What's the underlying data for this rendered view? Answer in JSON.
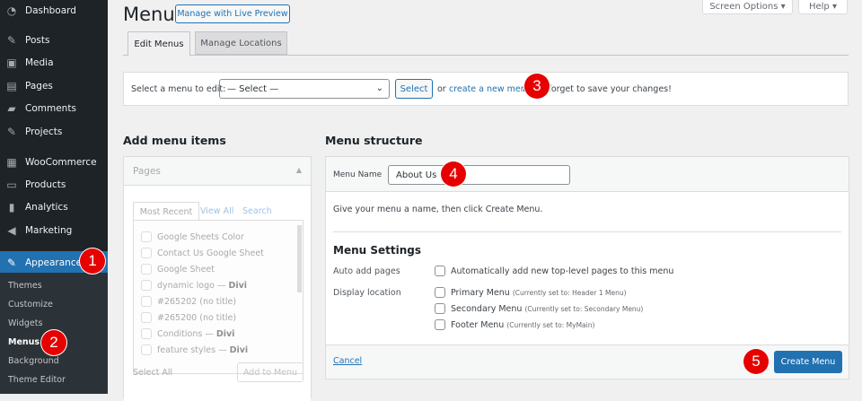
{
  "sidebar": {
    "items": [
      {
        "label": "Dashboard",
        "icon": "dashboard-icon"
      },
      {
        "label": "Posts",
        "icon": "pin-icon"
      },
      {
        "label": "Media",
        "icon": "media-icon"
      },
      {
        "label": "Pages",
        "icon": "pages-icon"
      },
      {
        "label": "Comments",
        "icon": "comment-icon"
      },
      {
        "label": "Projects",
        "icon": "pin-icon"
      },
      {
        "label": "WooCommerce",
        "icon": "woocommerce-icon"
      },
      {
        "label": "Products",
        "icon": "archive-icon"
      },
      {
        "label": "Analytics",
        "icon": "chart-icon"
      },
      {
        "label": "Marketing",
        "icon": "megaphone-icon"
      },
      {
        "label": "Appearance",
        "icon": "brush-icon"
      }
    ],
    "submenu": [
      "Themes",
      "Customize",
      "Widgets",
      "Menus",
      "Background",
      "Theme Editor"
    ]
  },
  "header": {
    "title": "Menus",
    "live_preview": "Manage with Live Preview",
    "screen_options": "Screen Options",
    "help": "Help"
  },
  "tabs": [
    "Edit Menus",
    "Manage Locations"
  ],
  "select_bar": {
    "label": "Select a menu to edit:",
    "selected": "— Select —",
    "button": "Select",
    "or": "or",
    "link": "create a new menu.",
    "note": "Don't forget to save your changes!"
  },
  "add_items": {
    "heading": "Add menu items",
    "section": "Pages",
    "tabs": [
      "Most Recent",
      "View All",
      "Search"
    ],
    "pages": [
      {
        "t": "Google Sheets Color"
      },
      {
        "t": "Contact Us Google Sheet"
      },
      {
        "t": "Google Sheet"
      },
      {
        "t": "dynamic logo —",
        "b": "Divi"
      },
      {
        "t": "#265202 (no title)"
      },
      {
        "t": "#265200 (no title)"
      },
      {
        "t": "Conditions —",
        "b": "Divi"
      },
      {
        "t": "feature styles —",
        "b": "Divi"
      }
    ],
    "select_all": "Select All",
    "add_button": "Add to Menu"
  },
  "structure": {
    "heading": "Menu structure",
    "name_label": "Menu Name",
    "name_value": "About Us",
    "hint": "Give your menu a name, then click Create Menu.",
    "settings_heading": "Menu Settings",
    "auto_label": "Auto add pages",
    "auto_option": "Automatically add new top-level pages to this menu",
    "location_label": "Display location",
    "locations": [
      {
        "name": "Primary Menu",
        "note": "(Currently set to: Header 1 Menu)"
      },
      {
        "name": "Secondary Menu",
        "note": "(Currently set to: Secondary Menu)"
      },
      {
        "name": "Footer Menu",
        "note": "(Currently set to: MyMain)"
      }
    ],
    "cancel": "Cancel",
    "create": "Create Menu"
  },
  "badges": [
    "1",
    "2",
    "3",
    "4",
    "5"
  ],
  "colors": {
    "accent": "#2271b1",
    "sidebar": "#1d2327",
    "badge": "#e60000"
  }
}
